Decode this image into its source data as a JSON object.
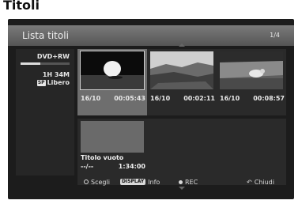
{
  "caption": "Titoli",
  "header": {
    "title": "Lista titoli",
    "page": "1/4"
  },
  "disc": {
    "type": "DVD+RW",
    "remaining_fraction": 0.4,
    "free_time": "1H 34M",
    "quality_badge": "SP",
    "free_label": "Libero"
  },
  "titles": [
    {
      "date": "16/10",
      "duration": "00:05:43",
      "selected": true,
      "thumb": "egg"
    },
    {
      "date": "16/10",
      "duration": "00:02:11",
      "selected": false,
      "thumb": "landscape"
    },
    {
      "date": "16/10",
      "duration": "00:08:57",
      "selected": false,
      "thumb": "animal"
    }
  ],
  "empty_title": {
    "label": "Titolo vuoto",
    "date": "--/--",
    "duration": "1:34:00"
  },
  "footer": {
    "select_label": "Scegli",
    "display_badge": "DISPLAY",
    "info_label": "Info",
    "rec_label": "REC",
    "close_label": "Chiudi"
  },
  "colors": {
    "background": "#1c1c1c",
    "header_gradient_top": "#7a7a7a",
    "selected_tile": "#6e6e6e"
  }
}
